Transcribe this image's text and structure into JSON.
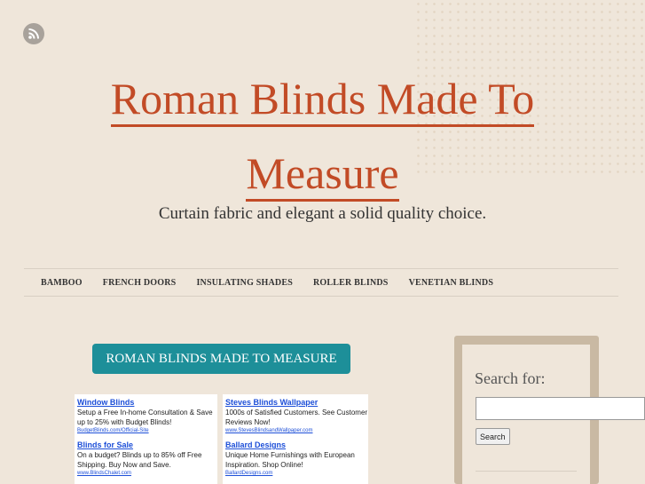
{
  "site": {
    "title_line1": "Roman Blinds Made To",
    "title_line2": "Measure",
    "tagline": "Curtain fabric and elegant a solid quality choice."
  },
  "icons": {
    "rss": "rss-icon"
  },
  "nav": {
    "items": [
      {
        "label": "BAMBOO"
      },
      {
        "label": "FRENCH DOORS"
      },
      {
        "label": "INSULATING SHADES"
      },
      {
        "label": "ROLLER BLINDS"
      },
      {
        "label": "VENETIAN BLINDS"
      }
    ]
  },
  "main": {
    "headline": "ROMAN BLINDS MADE TO MEASURE"
  },
  "ads": {
    "left": [
      {
        "title": "Window Blinds",
        "text": "Setup a Free In-home Consultation & Save up to 25% with Budget Blinds!",
        "url": "BudgetBlinds.com/Official-Site"
      },
      {
        "title": "Blinds for Sale",
        "text": "On a budget? Blinds up to 85% off Free Shipping. Buy Now and Save.",
        "url": "www.BlindsChalet.com"
      }
    ],
    "right": [
      {
        "title": "Steves Blinds Wallpaper",
        "text": "1000s of Satisfied Customers. See Customer Reviews Now!",
        "url": "www.StevesBlindsandWallpaper.com"
      },
      {
        "title": "Ballard Designs",
        "text": "Unique Home Furnishings with European Inspiration. Shop Online!",
        "url": "BallardDesigns.com"
      }
    ]
  },
  "sidebar": {
    "search_label": "Search for:",
    "search_value": "",
    "search_button": "Search"
  },
  "colors": {
    "title": "#c24b26",
    "headline_bg": "#1d8f99",
    "background": "#efe6da",
    "sidebar_frame": "#c9b9a3",
    "ad_link": "#1d4fd8"
  }
}
